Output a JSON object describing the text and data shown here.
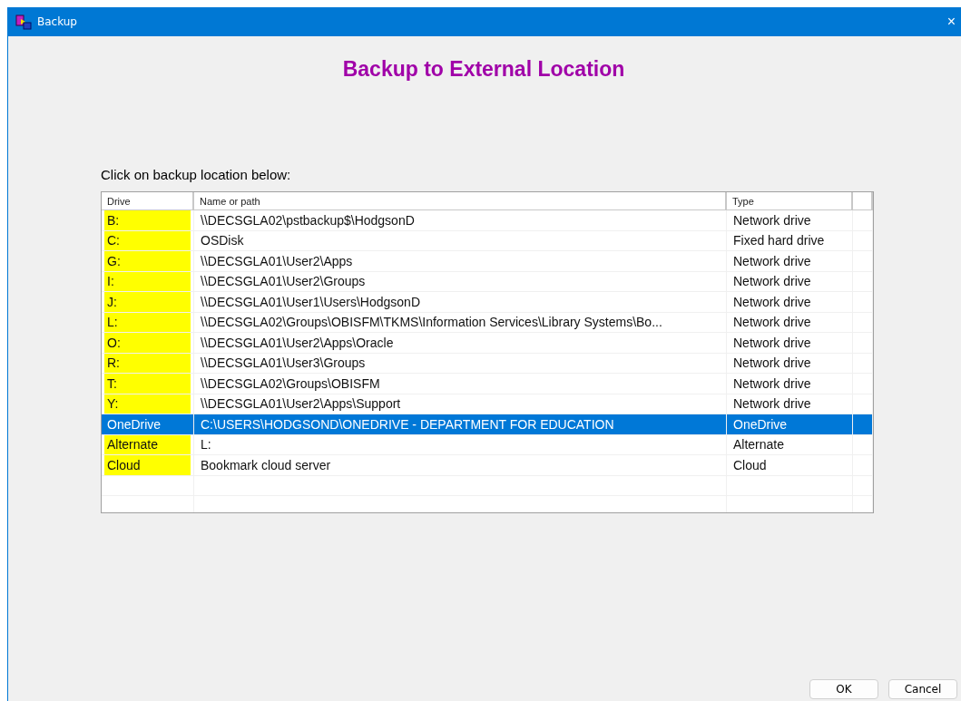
{
  "window": {
    "title": "Backup",
    "close": "×"
  },
  "heading": "Backup to External Location",
  "instruction": "Click on backup location below:",
  "table": {
    "columns": [
      "Drive",
      "Name or path",
      "Type"
    ],
    "rows": [
      {
        "drive": "B:",
        "path": "\\\\DECSGLA02\\pstbackup$\\HodgsonD",
        "type": "Network drive",
        "selected": false
      },
      {
        "drive": "C:",
        "path": "OSDisk",
        "type": "Fixed hard drive",
        "selected": false
      },
      {
        "drive": "G:",
        "path": "\\\\DECSGLA01\\User2\\Apps",
        "type": "Network drive",
        "selected": false
      },
      {
        "drive": "I:",
        "path": "\\\\DECSGLA01\\User2\\Groups",
        "type": "Network drive",
        "selected": false
      },
      {
        "drive": "J:",
        "path": "\\\\DECSGLA01\\User1\\Users\\HodgsonD",
        "type": "Network drive",
        "selected": false
      },
      {
        "drive": "L:",
        "path": "\\\\DECSGLA02\\Groups\\OBISFM\\TKMS\\Information Services\\Library Systems\\Bo...",
        "type": "Network drive",
        "selected": false
      },
      {
        "drive": "O:",
        "path": "\\\\DECSGLA01\\User2\\Apps\\Oracle",
        "type": "Network drive",
        "selected": false
      },
      {
        "drive": "R:",
        "path": "\\\\DECSGLA01\\User3\\Groups",
        "type": "Network drive",
        "selected": false
      },
      {
        "drive": "T:",
        "path": "\\\\DECSGLA02\\Groups\\OBISFM",
        "type": "Network drive",
        "selected": false
      },
      {
        "drive": "Y:",
        "path": "\\\\DECSGLA01\\User2\\Apps\\Support",
        "type": "Network drive",
        "selected": false
      },
      {
        "drive": "OneDrive",
        "path": "C:\\USERS\\HODGSOND\\ONEDRIVE - DEPARTMENT FOR EDUCATION",
        "type": "OneDrive",
        "selected": true
      },
      {
        "drive": "Alternate",
        "path": "L:",
        "type": "Alternate",
        "selected": false
      },
      {
        "drive": "Cloud",
        "path": "Bookmark cloud server",
        "type": "Cloud",
        "selected": false
      }
    ]
  },
  "buttons": [
    "OK",
    "Cancel"
  ]
}
